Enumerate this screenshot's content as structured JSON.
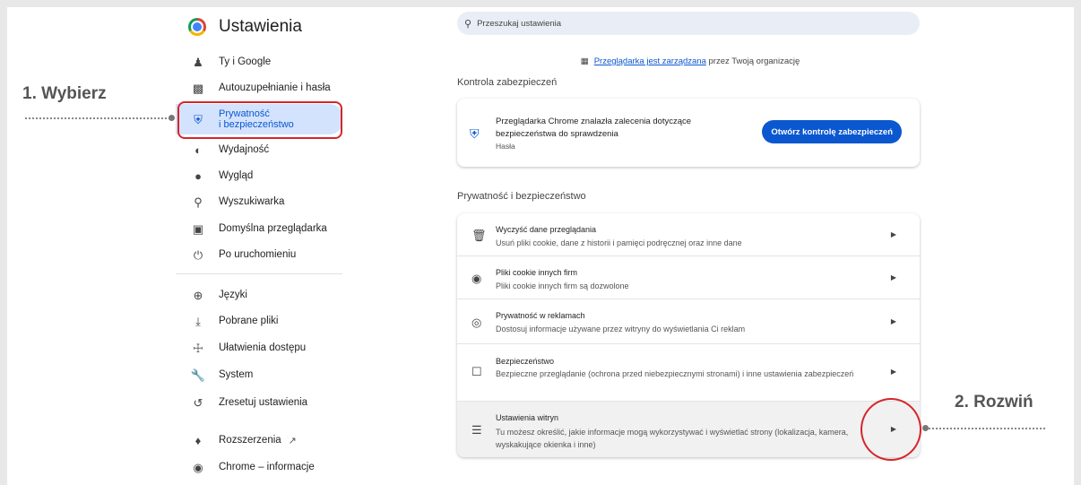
{
  "sidebar": {
    "title": "Ustawienia",
    "items": [
      {
        "label": "Ty i Google",
        "icon": "person-icon"
      },
      {
        "label": "Autouzupełnianie i hasła",
        "icon": "clipboard-icon"
      },
      {
        "label": "Prywatność\ni bezpieczeństwo",
        "icon": "shield-icon"
      },
      {
        "label": "Wydajność",
        "icon": "speedometer-icon"
      },
      {
        "label": "Wygląd",
        "icon": "palette-icon"
      },
      {
        "label": "Wyszukiwarka",
        "icon": "search-icon"
      },
      {
        "label": "Domyślna przeglądarka",
        "icon": "browser-icon"
      },
      {
        "label": "Po uruchomieniu",
        "icon": "power-icon"
      },
      {
        "label": "Języki",
        "icon": "globe-icon"
      },
      {
        "label": "Pobrane pliki",
        "icon": "download-icon"
      },
      {
        "label": "Ułatwienia dostępu",
        "icon": "accessibility-icon"
      },
      {
        "label": "System",
        "icon": "wrench-icon"
      },
      {
        "label": "Zresetuj ustawienia",
        "icon": "reset-icon"
      },
      {
        "label": "Rozszerzenia",
        "icon": "puzzle-icon"
      },
      {
        "label": "Chrome – informacje",
        "icon": "chrome-icon"
      }
    ],
    "external_icon": "external-link-icon"
  },
  "search": {
    "placeholder": "Przeszukaj ustawienia"
  },
  "managed": {
    "link": "Przeglądarka jest zarządzana",
    "rest": " przez Twoją organizację"
  },
  "safety_check": {
    "section_title": "Kontrola zabezpieczeń",
    "line1": "Przeglądarka Chrome znalazła zalecenia dotyczące",
    "line2": "bezpieczeństwa do sprawdzenia",
    "sub": "Hasła",
    "button": "Otwórz kontrolę zabezpieczeń"
  },
  "privacy": {
    "section_title": "Prywatność i bezpieczeństwo",
    "rows": [
      {
        "title": "Wyczyść dane przeglądania",
        "desc": "Usuń pliki cookie, dane z historii i pamięci podręcznej oraz inne dane",
        "icon": "trash-icon"
      },
      {
        "title": "Pliki cookie innych firm",
        "desc": "Pliki cookie innych firm są dozwolone",
        "icon": "cookie-icon"
      },
      {
        "title": "Prywatność w reklamach",
        "desc": "Dostosuj informacje używane przez witryny do wyświetlania Ci reklam",
        "icon": "ads-privacy-icon"
      },
      {
        "title": "Bezpieczeństwo",
        "desc": "Bezpieczne przeglądanie (ochrona przed niebezpiecznymi stronami) i inne ustawienia zabezpieczeń",
        "icon": "lock-icon"
      },
      {
        "title": "Ustawienia witryn",
        "desc": "Tu możesz określić, jakie informacje mogą wykorzystywać i wyświetlać strony (lokalizacja, kamera, wyskakujące okienka i inne)",
        "icon": "sliders-icon"
      }
    ]
  },
  "annotations": {
    "step1": "1. Wybierz",
    "step2": "2. Rozwiń"
  },
  "colors": {
    "accent": "#0b57d0",
    "highlight": "#d6252b",
    "active_bg": "#d3e3fd"
  }
}
